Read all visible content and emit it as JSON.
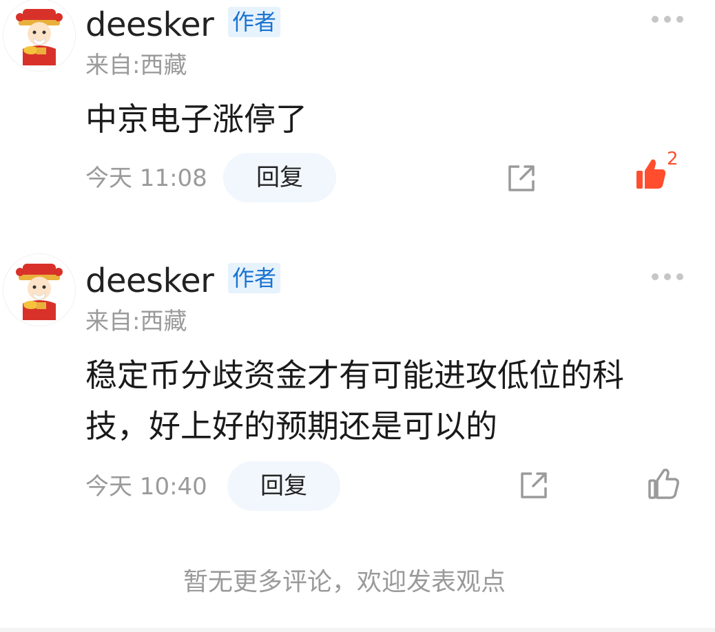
{
  "comments": [
    {
      "username": "deesker",
      "badge": "作者",
      "location": "来自:西藏",
      "content": "中京电子涨停了",
      "time": "今天 11:08",
      "reply_label": "回复",
      "like_count": "2",
      "liked": true,
      "avatar_icon": "god-of-wealth-avatar",
      "share_icon": "share-icon",
      "like_icon": "thumbs-up-icon",
      "more_icon": "more-dots-icon"
    },
    {
      "username": "deesker",
      "badge": "作者",
      "location": "来自:西藏",
      "content_line1": "稳定币分歧资金才有可能进攻低位的科",
      "content_line2": "技，好上好的预期还是可以的",
      "time": "今天 10:40",
      "reply_label": "回复",
      "liked": false,
      "avatar_icon": "god-of-wealth-avatar",
      "share_icon": "share-icon",
      "like_icon": "thumbs-up-icon",
      "more_icon": "more-dots-icon"
    }
  ],
  "footer": {
    "text": "暂无更多评论，欢迎发表观点"
  },
  "colors": {
    "accent_blue": "#1a73d1",
    "badge_bg": "#e6f2fc",
    "like_active": "#ff4d2e",
    "muted_text": "#9a9a9a",
    "reply_bg": "#f1f7fd"
  }
}
